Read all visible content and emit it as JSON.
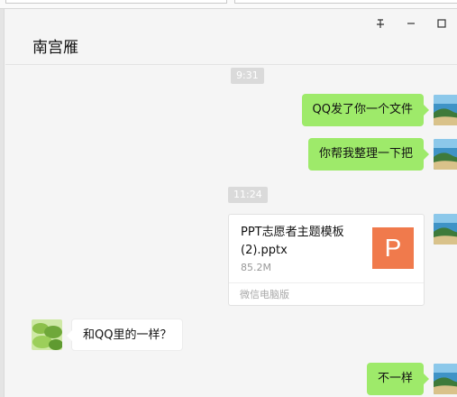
{
  "window": {
    "controls": [
      {
        "icon": "pin-icon",
        "glyph": "⊥"
      },
      {
        "icon": "minimize-icon"
      },
      {
        "icon": "maximize-icon"
      }
    ]
  },
  "header": {
    "title": "南宫雁"
  },
  "messages": [
    {
      "type": "time",
      "text": "9:31"
    },
    {
      "type": "text",
      "side": "right",
      "text": "QQ发了你一个文件"
    },
    {
      "type": "text",
      "side": "right",
      "text": "你帮我整理一下把"
    },
    {
      "type": "time",
      "text": "11:24"
    },
    {
      "type": "file",
      "side": "right",
      "file_name": "PPT志愿者主题模板(2).pptx",
      "file_size": "85.2M",
      "file_icon_letter": "P",
      "source": "微信电脑版"
    },
    {
      "type": "text",
      "side": "left",
      "text": "和QQ里的一样？"
    },
    {
      "type": "text",
      "side": "right",
      "text": "不一样"
    }
  ],
  "colors": {
    "bubble_self": "#9eea6a",
    "bubble_other": "#ffffff",
    "ppt_icon": "#f07a4c",
    "background": "#f5f5f5"
  }
}
